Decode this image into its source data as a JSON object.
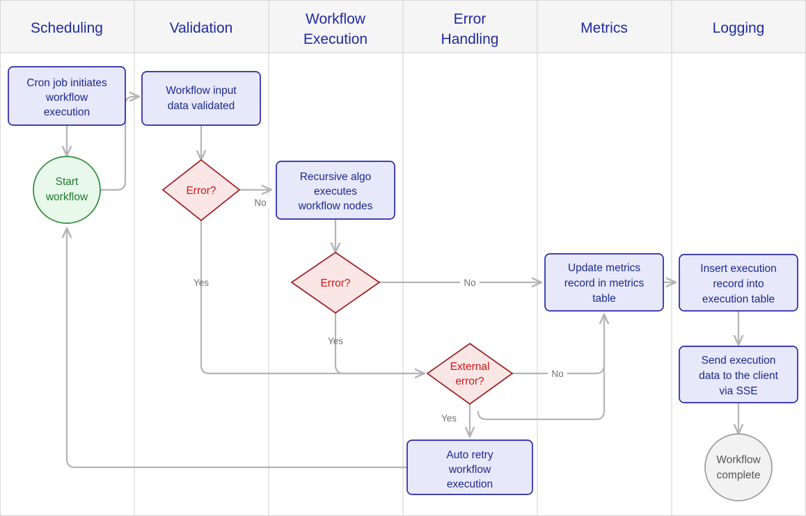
{
  "diagram": {
    "title": "Workflow execution swimlane flowchart",
    "colors": {
      "lane_header_bg": "#f5f5f5",
      "lane_header_text": "#1f2a9e",
      "process_fill": "#e8e8fb",
      "process_border": "#2727a8",
      "process_text": "#1a2a8a",
      "decision_fill": "#fbe6e6",
      "decision_border": "#9e1b1b",
      "decision_text": "#d01515",
      "start_fill": "#e8f8ea",
      "start_border": "#2d8a3c",
      "start_text": "#1d7a2e",
      "end_fill": "#f2f2f2",
      "end_border": "#9a9a9a",
      "end_text": "#555555",
      "edge": "#b4b4b4",
      "edge_label": "#707070",
      "grid": "#cfcfcf"
    },
    "lanes": [
      {
        "id": "scheduling",
        "label": "Scheduling"
      },
      {
        "id": "validation",
        "label": "Validation"
      },
      {
        "id": "workflow-execution",
        "label": "Workflow Execution"
      },
      {
        "id": "error-handling",
        "label": "Error Handling"
      },
      {
        "id": "metrics",
        "label": "Metrics"
      },
      {
        "id": "logging",
        "label": "Logging"
      }
    ],
    "nodes": [
      {
        "id": "cron-job",
        "lane": "scheduling",
        "shape": "process",
        "label": "Cron job initiates workflow execution"
      },
      {
        "id": "start-workflow",
        "lane": "scheduling",
        "shape": "start",
        "label": "Start workflow"
      },
      {
        "id": "workflow-input-validated",
        "lane": "validation",
        "shape": "process",
        "label": "Workflow input data validated"
      },
      {
        "id": "validation-error",
        "lane": "validation",
        "shape": "decision",
        "label": "Error?"
      },
      {
        "id": "recursive-algo",
        "lane": "workflow-execution",
        "shape": "process",
        "label": "Recursive algo executes workflow nodes"
      },
      {
        "id": "execution-error",
        "lane": "workflow-execution",
        "shape": "decision",
        "label": "Error?"
      },
      {
        "id": "external-error",
        "lane": "error-handling",
        "shape": "decision",
        "label": "External error?"
      },
      {
        "id": "auto-retry",
        "lane": "error-handling",
        "shape": "process",
        "label": "Auto retry workflow execution"
      },
      {
        "id": "update-metrics",
        "lane": "metrics",
        "shape": "process",
        "label": "Update metrics record in metrics table"
      },
      {
        "id": "insert-execution-record",
        "lane": "logging",
        "shape": "process",
        "label": "Insert execution record into execution table"
      },
      {
        "id": "send-execution-data",
        "lane": "logging",
        "shape": "process",
        "label": "Send execution data to the client via SSE"
      },
      {
        "id": "workflow-complete",
        "lane": "logging",
        "shape": "end",
        "label": "Workflow complete"
      }
    ],
    "edges": [
      {
        "from": "cron-job",
        "to": "start-workflow",
        "label": ""
      },
      {
        "from": "start-workflow",
        "to": "workflow-input-validated",
        "label": ""
      },
      {
        "from": "workflow-input-validated",
        "to": "validation-error",
        "label": ""
      },
      {
        "from": "validation-error",
        "to": "recursive-algo",
        "label": "No"
      },
      {
        "from": "validation-error",
        "to": "external-error",
        "label": "Yes"
      },
      {
        "from": "recursive-algo",
        "to": "execution-error",
        "label": ""
      },
      {
        "from": "execution-error",
        "to": "update-metrics",
        "label": "No"
      },
      {
        "from": "execution-error",
        "to": "external-error",
        "label": "Yes"
      },
      {
        "from": "external-error",
        "to": "update-metrics",
        "label": "No"
      },
      {
        "from": "external-error",
        "to": "auto-retry",
        "label": "Yes"
      },
      {
        "from": "auto-retry",
        "to": "update-metrics",
        "label": ""
      },
      {
        "from": "auto-retry",
        "to": "start-workflow",
        "label": ""
      },
      {
        "from": "update-metrics",
        "to": "insert-execution-record",
        "label": ""
      },
      {
        "from": "insert-execution-record",
        "to": "send-execution-data",
        "label": ""
      },
      {
        "from": "send-execution-data",
        "to": "workflow-complete",
        "label": ""
      }
    ],
    "node_text_lines": {
      "cron-job": [
        "Cron job initiates",
        "workflow",
        "execution"
      ],
      "start-workflow": [
        "Start",
        "workflow"
      ],
      "workflow-input-validated": [
        "Workflow input",
        "data validated"
      ],
      "validation-error": [
        "Error?"
      ],
      "recursive-algo": [
        "Recursive algo",
        "executes",
        "workflow nodes"
      ],
      "execution-error": [
        "Error?"
      ],
      "external-error": [
        "External",
        "error?"
      ],
      "auto-retry": [
        "Auto retry",
        "workflow",
        "execution"
      ],
      "update-metrics": [
        "Update metrics",
        "record in metrics",
        "table"
      ],
      "insert-execution-record": [
        "Insert execution",
        "record into",
        "execution table"
      ],
      "send-execution-data": [
        "Send execution",
        "data to the client",
        "via SSE"
      ],
      "workflow-complete": [
        "Workflow",
        "complete"
      ]
    },
    "edge_labels": {
      "validation_no": "No",
      "validation_yes": "Yes",
      "execution_no": "No",
      "execution_yes": "Yes",
      "external_no": "No",
      "external_yes": "Yes"
    }
  }
}
